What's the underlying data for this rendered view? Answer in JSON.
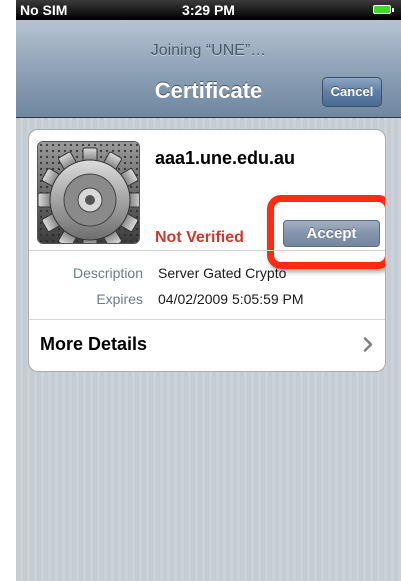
{
  "status_bar": {
    "carrier": "No SIM",
    "time": "3:29 PM",
    "battery_icon": "battery-icon"
  },
  "nav_bar": {
    "prompt": "Joining “UNE”…",
    "title": "Certificate",
    "cancel_label": "Cancel"
  },
  "certificate": {
    "icon": "gear-icon",
    "host": "aaa1.une.edu.au",
    "verification_status": "Not Verified",
    "accept_label": "Accept",
    "details": [
      {
        "label": "Description",
        "value": "Server Gated Crypto"
      },
      {
        "label": "Expires",
        "value": "04/02/2009 5:05:59 PM"
      }
    ],
    "more_details_label": "More Details",
    "more_details_icon": "chevron-right-icon"
  },
  "colors": {
    "not_verified": "#c93a33",
    "highlight": "#ff2b12",
    "background": "#c5ccd4"
  }
}
